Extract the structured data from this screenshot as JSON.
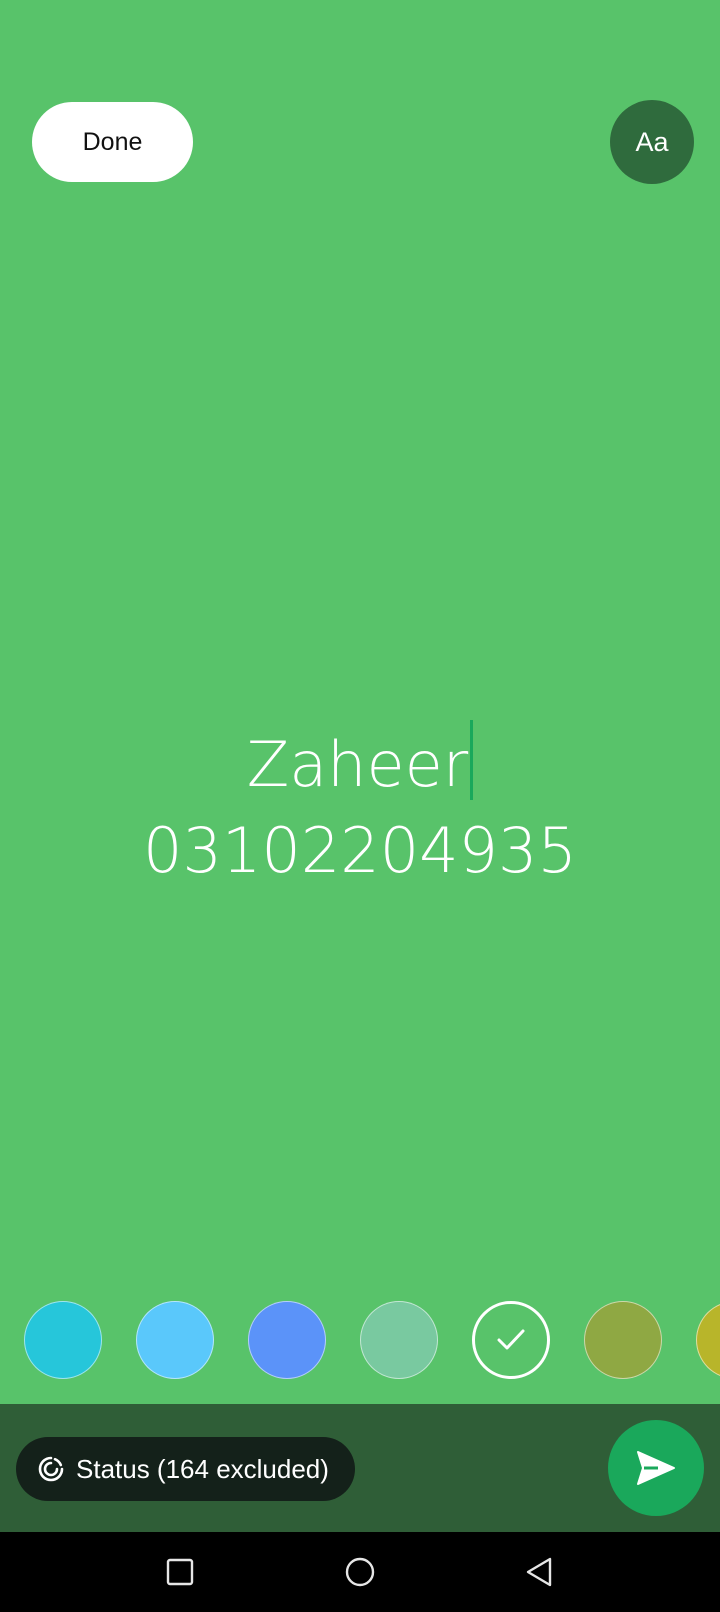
{
  "toolbar": {
    "done_label": "Done",
    "font_label": "Aa"
  },
  "status_text": {
    "line1": "Zaheer",
    "line2": "03102204935"
  },
  "swatches": [
    {
      "color": "#26c6da",
      "selected": false
    },
    {
      "color": "#5ac8fb",
      "selected": false
    },
    {
      "color": "#5b93f9",
      "selected": false
    },
    {
      "color": "#79c9a0",
      "selected": false
    },
    {
      "color": "#58c36a",
      "selected": true
    },
    {
      "color": "#8fa843",
      "selected": false
    },
    {
      "color": "#b8b52a",
      "selected": false
    }
  ],
  "audience": {
    "label": "Status (164 excluded)",
    "icon": "status-ring-icon"
  },
  "send": {
    "icon": "send-icon"
  },
  "colors": {
    "background": "#58c36a",
    "bottom_bar": "#2f5e37",
    "accent": "#1aa85b"
  },
  "navigation": {
    "recent": "square-icon",
    "home": "circle-icon",
    "back": "triangle-back-icon"
  }
}
